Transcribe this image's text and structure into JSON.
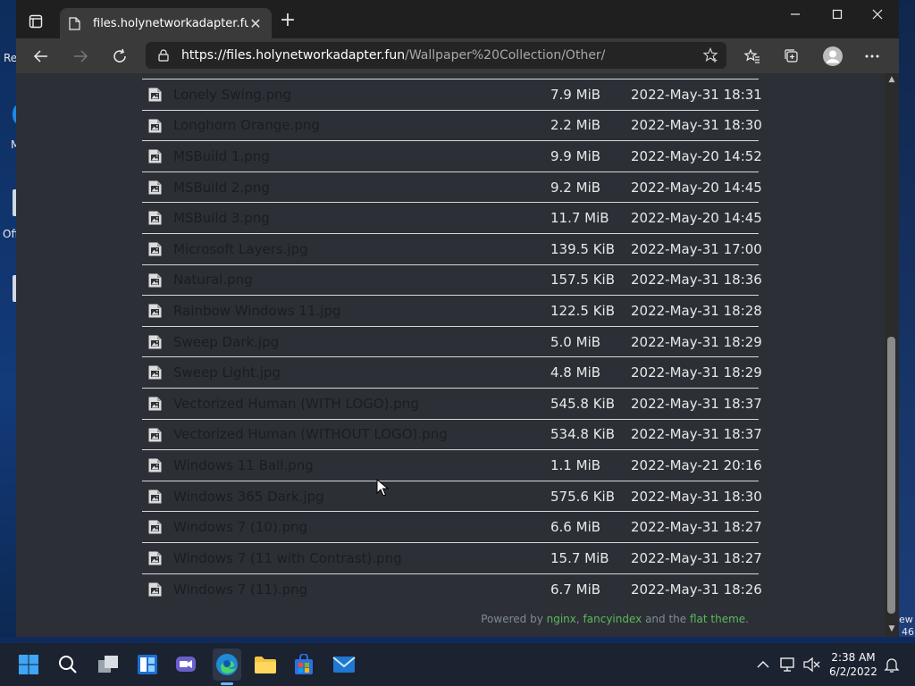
{
  "desktop": {
    "left_fragments": [
      "Re",
      "M",
      "Off"
    ],
    "right_fragments": [
      "ew",
      "46"
    ]
  },
  "tab": {
    "title": "files.holynetworkadapter.fun",
    "close": "✕"
  },
  "address": {
    "host": "https://files.holynetworkadapter.fun",
    "path": "/Wallpaper%20Collection/Other/"
  },
  "files": [
    {
      "name": "Lonely Swing.png",
      "size": "7.9 MiB",
      "date": "2022-May-31 18:31"
    },
    {
      "name": "Longhorn Orange.png",
      "size": "2.2 MiB",
      "date": "2022-May-31 18:30"
    },
    {
      "name": "MSBuild 1.png",
      "size": "9.9 MiB",
      "date": "2022-May-20 14:52"
    },
    {
      "name": "MSBuild 2.png",
      "size": "9.2 MiB",
      "date": "2022-May-20 14:45"
    },
    {
      "name": "MSBuild 3.png",
      "size": "11.7 MiB",
      "date": "2022-May-20 14:45"
    },
    {
      "name": "Microsoft Layers.jpg",
      "size": "139.5 KiB",
      "date": "2022-May-31 17:00"
    },
    {
      "name": "Natural.png",
      "size": "157.5 KiB",
      "date": "2022-May-31 18:36"
    },
    {
      "name": "Rainbow Windows 11.jpg",
      "size": "122.5 KiB",
      "date": "2022-May-31 18:28"
    },
    {
      "name": "Sweep Dark.jpg",
      "size": "5.0 MiB",
      "date": "2022-May-31 18:29"
    },
    {
      "name": "Sweep Light.jpg",
      "size": "4.8 MiB",
      "date": "2022-May-31 18:29"
    },
    {
      "name": "Vectorized Human (WITH LOGO).png",
      "size": "545.8 KiB",
      "date": "2022-May-31 18:37"
    },
    {
      "name": "Vectorized Human (WITHOUT LOGO).png",
      "size": "534.8 KiB",
      "date": "2022-May-31 18:37"
    },
    {
      "name": "Windows 11 Ball.png",
      "size": "1.1 MiB",
      "date": "2022-May-21 20:16"
    },
    {
      "name": "Windows 365 Dark.jpg",
      "size": "575.6 KiB",
      "date": "2022-May-31 18:30"
    },
    {
      "name": "Windows 7 (10).png",
      "size": "6.6 MiB",
      "date": "2022-May-31 18:27"
    },
    {
      "name": "Windows 7 (11 with Contrast).png",
      "size": "15.7 MiB",
      "date": "2022-May-31 18:27"
    },
    {
      "name": "Windows 7 (11).png",
      "size": "6.7 MiB",
      "date": "2022-May-31 18:26"
    }
  ],
  "footer": {
    "prefix": "Powered by ",
    "link1": "nginx",
    "sep": ", ",
    "link2": "fancyindex",
    "mid": " and the ",
    "link3": "flat theme",
    "suffix": "."
  },
  "taskbar": {
    "time": "2:38 AM",
    "date": "6/2/2022"
  },
  "colors": {
    "page_bg": "#2c3036",
    "link_green": "#5db85d",
    "file_name": "#1a1d21"
  }
}
